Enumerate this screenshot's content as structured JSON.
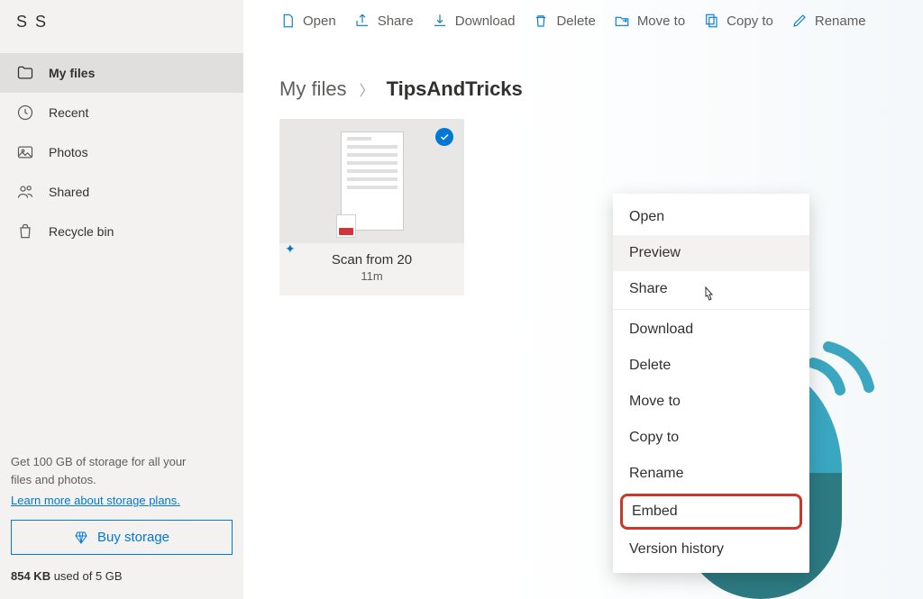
{
  "brand": "S S",
  "sidebar": {
    "items": [
      {
        "label": "My files"
      },
      {
        "label": "Recent"
      },
      {
        "label": "Photos"
      },
      {
        "label": "Shared"
      },
      {
        "label": "Recycle bin"
      }
    ]
  },
  "storage": {
    "promo_line1": "Get 100 GB of storage for all your",
    "promo_line2": "files and photos.",
    "learn_more": "Learn more about storage plans.",
    "buy_label": "Buy storage",
    "used": "854 KB",
    "used_suffix": " used of 5 GB"
  },
  "toolbar": {
    "open": "Open",
    "share": "Share",
    "download": "Download",
    "delete": "Delete",
    "move": "Move to",
    "copy": "Copy to",
    "rename": "Rename"
  },
  "breadcrumb": {
    "root": "My files",
    "current": "TipsAndTricks"
  },
  "file": {
    "name": "Scan from 20",
    "meta": "11m"
  },
  "context_menu": {
    "open": "Open",
    "preview": "Preview",
    "share": "Share",
    "download": "Download",
    "delete": "Delete",
    "move": "Move to",
    "copy": "Copy to",
    "rename": "Rename",
    "embed": "Embed",
    "version": "Version history"
  }
}
